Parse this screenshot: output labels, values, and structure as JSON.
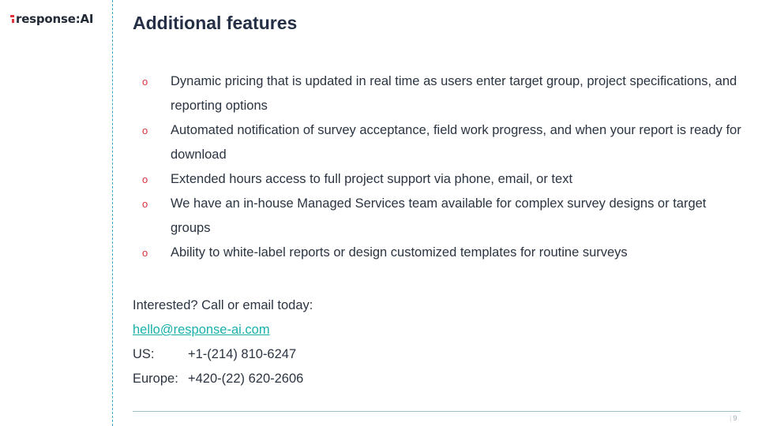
{
  "logo": {
    "text": "response:AI"
  },
  "title": "Additional features",
  "bullets": [
    "Dynamic pricing that is updated in real time as users enter target group, project specifications, and reporting options",
    "Automated notification of survey acceptance, field work progress, and when your report is ready for download",
    "Extended hours access to full project support via phone, email, or text",
    "We have an in-house Managed Services team available for complex survey designs or target groups",
    "Ability to white-label reports or design customized templates for routine surveys"
  ],
  "bullet_marker": "o",
  "contact": {
    "intro": "Interested? Call or email today:",
    "email": "hello@response-ai.com",
    "us_label": "US:",
    "us_phone": "+1-(214) 810-6247",
    "europe_label": "Europe:",
    "europe_phone": "+420-(22) 620-2606"
  },
  "page_number": "9",
  "colors": {
    "accent_red": "#e0323b",
    "link_teal": "#1ab0a9",
    "divider_blue": "#3aa7c9"
  }
}
